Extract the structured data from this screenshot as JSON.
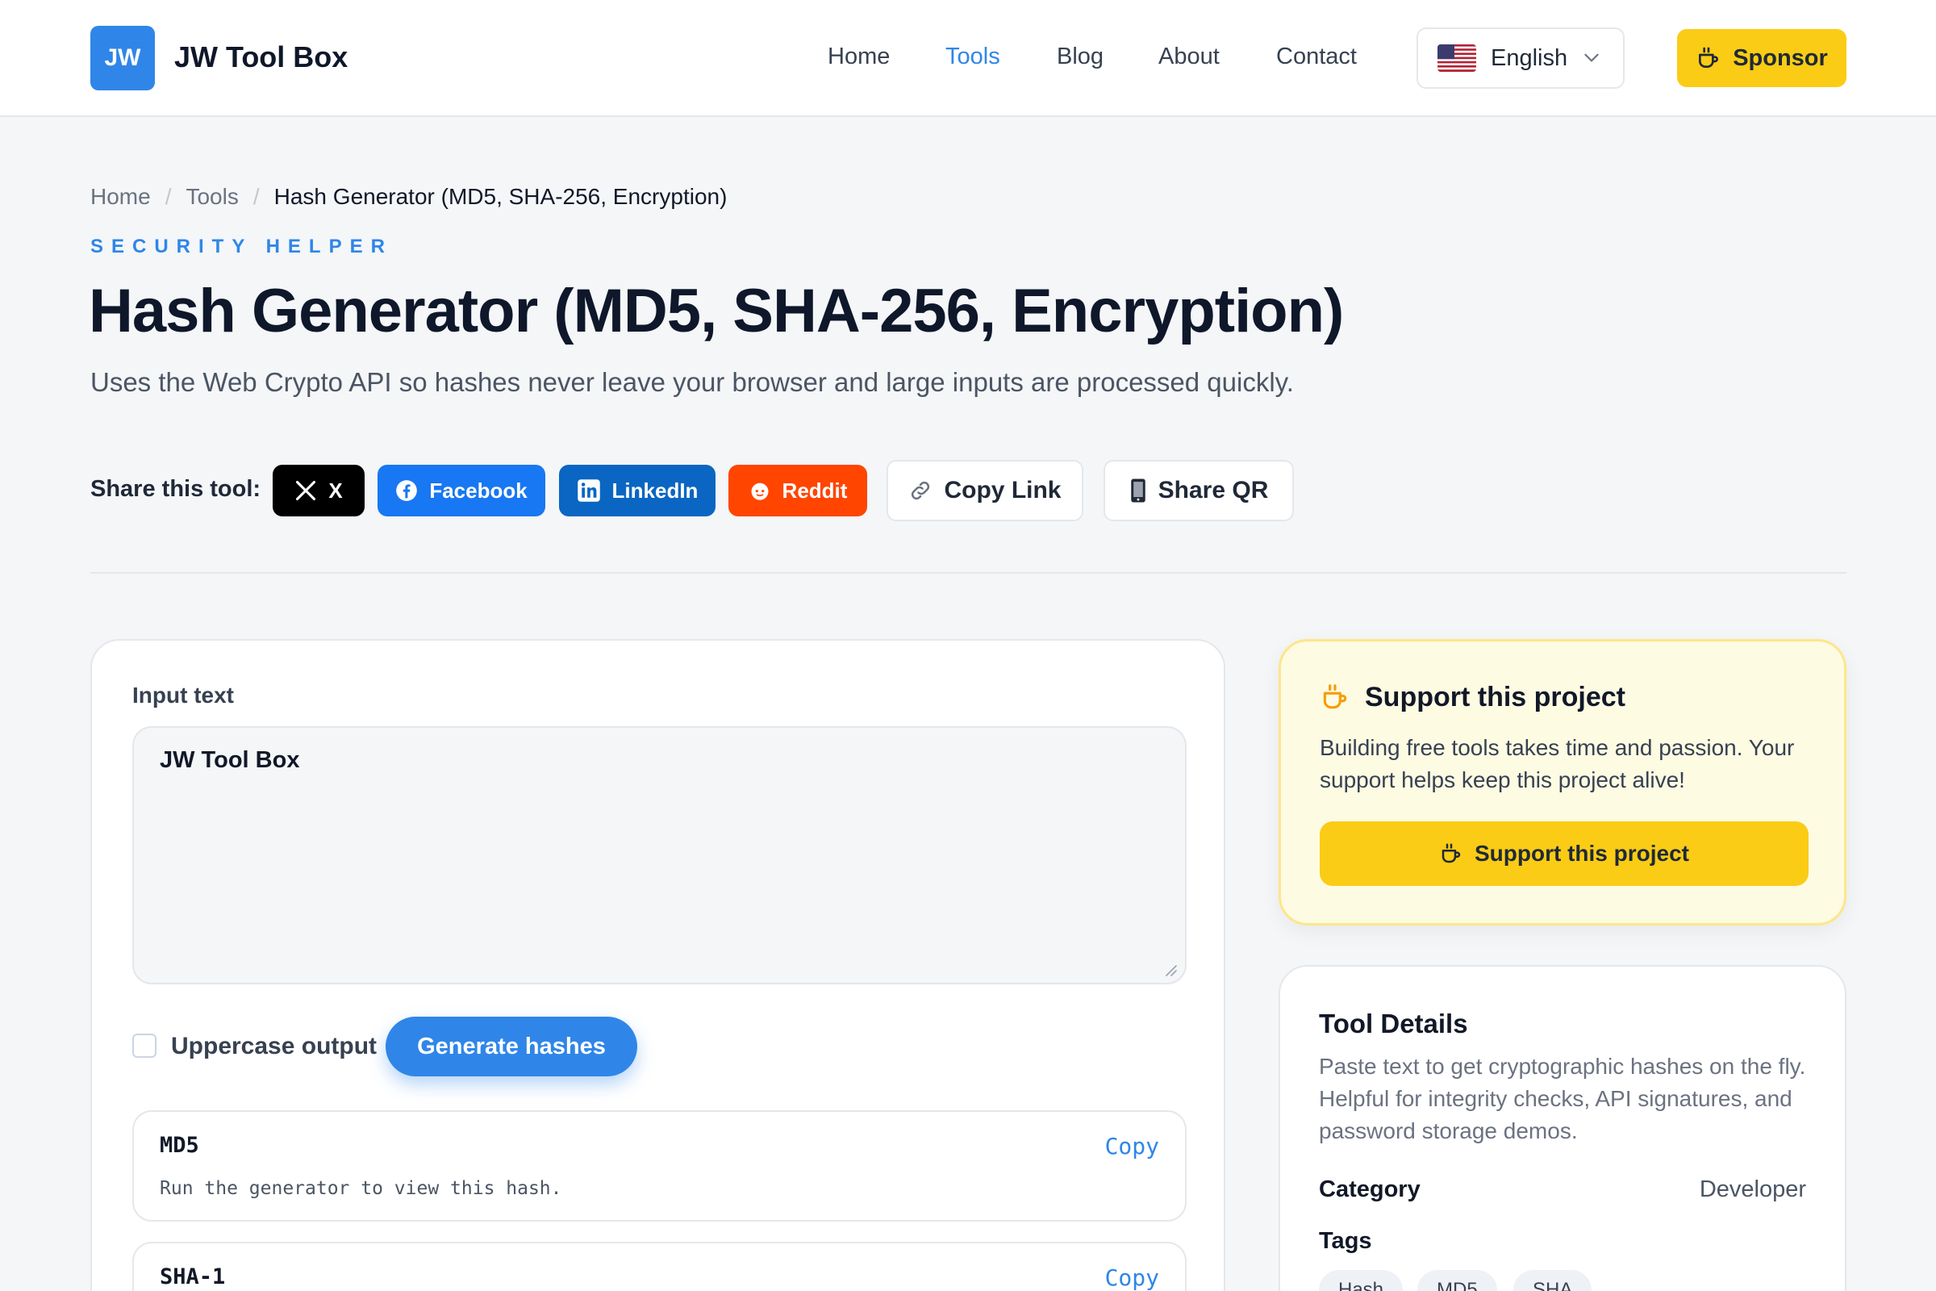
{
  "header": {
    "logo_text": "JW",
    "brand": "JW Tool Box",
    "nav": [
      {
        "label": "Home",
        "active": false
      },
      {
        "label": "Tools",
        "active": true
      },
      {
        "label": "Blog",
        "active": false
      },
      {
        "label": "About",
        "active": false
      },
      {
        "label": "Contact",
        "active": false
      }
    ],
    "language": {
      "label": "English",
      "flag_icon": "us-flag-icon"
    },
    "sponsor_label": "Sponsor"
  },
  "breadcrumb": [
    "Home",
    "Tools",
    "Hash Generator (MD5, SHA-256, Encryption)"
  ],
  "hero": {
    "eyebrow": "SECURITY HELPER",
    "title": "Hash Generator (MD5, SHA-256, Encryption)",
    "description": "Uses the Web Crypto API so hashes never leave your browser and large inputs are processed quickly."
  },
  "share": {
    "label": "Share this tool:",
    "buttons": [
      {
        "label": "X",
        "icon": "x-logo-icon",
        "color": "#000000"
      },
      {
        "label": "Facebook",
        "icon": "facebook-icon",
        "color": "#1877f2"
      },
      {
        "label": "LinkedIn",
        "icon": "linkedin-icon",
        "color": "#0a66c2"
      },
      {
        "label": "Reddit",
        "icon": "reddit-icon",
        "color": "#ff4500"
      },
      {
        "label": "Copy Link",
        "icon": "link-icon"
      },
      {
        "label": "Share QR",
        "icon": "phone-icon"
      }
    ]
  },
  "tool": {
    "input_label": "Input text",
    "input_value": "JW Tool Box",
    "uppercase_label": "Uppercase output",
    "uppercase_checked": false,
    "generate_label": "Generate hashes",
    "hashes": [
      {
        "name": "MD5",
        "copy_label": "Copy",
        "value": "Run the generator to view this hash."
      },
      {
        "name": "SHA-1",
        "copy_label": "Copy",
        "value": ""
      }
    ]
  },
  "support": {
    "title": "Support this project",
    "text": "Building free tools takes time and passion. Your support helps keep this project alive!",
    "button_label": "Support this project"
  },
  "details": {
    "title": "Tool Details",
    "text": "Paste text to get cryptographic hashes on the fly. Helpful for integrity checks, API signatures, and password storage demos.",
    "category_label": "Category",
    "category_value": "Developer",
    "tags_label": "Tags",
    "tags": [
      "Hash",
      "MD5",
      "SHA"
    ]
  },
  "colors": {
    "accent": "#2f86e8",
    "sponsor": "#facc15",
    "support_bg": "#fefbe3"
  }
}
